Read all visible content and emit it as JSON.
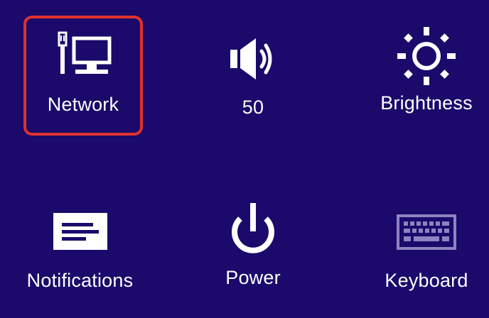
{
  "quick_settings": {
    "network": {
      "label": "Network",
      "icon": "network-icon",
      "highlight_color": "#e0312e"
    },
    "volume": {
      "label": "50",
      "icon": "speaker-icon"
    },
    "brightness": {
      "label": "Brightness",
      "icon": "sun-icon"
    },
    "notifications": {
      "label": "Notifications",
      "icon": "notifications-icon"
    },
    "power": {
      "label": "Power",
      "icon": "power-icon"
    },
    "keyboard": {
      "label": "Keyboard",
      "icon": "keyboard-icon",
      "state": "disabled"
    }
  },
  "colors": {
    "background": "#1b0a6b",
    "foreground": "#ffffff",
    "disabled_icon": "#8d84c0"
  }
}
